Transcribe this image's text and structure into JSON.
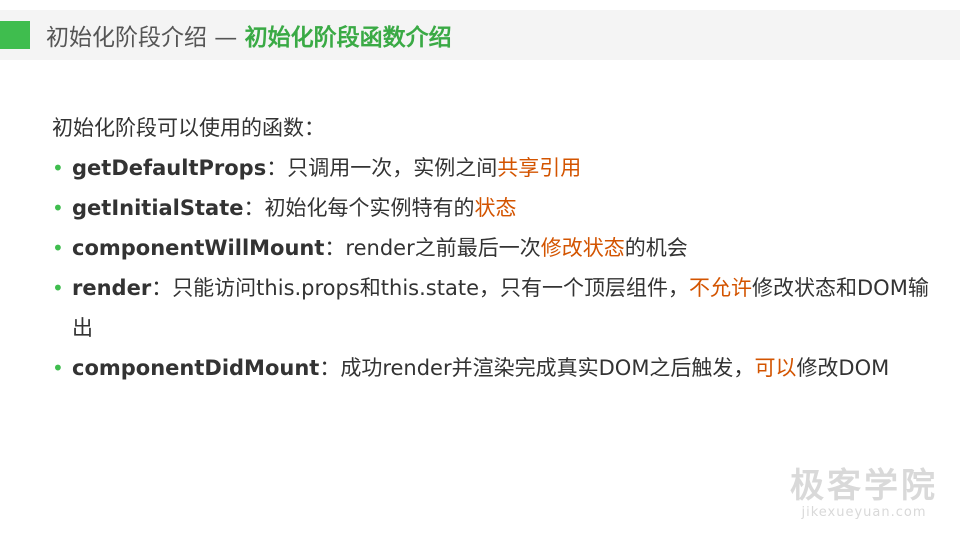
{
  "header": {
    "section": "初始化阶段介绍 — ",
    "subtitle": "初始化阶段函数介绍"
  },
  "intro": "初始化阶段可以使用的函数：",
  "items": [
    {
      "term": "getDefaultProps",
      "sep": "：",
      "text1": "只调用一次，实例之间",
      "highlight": "共享引用",
      "text2": ""
    },
    {
      "term": "getInitialState",
      "sep": "：",
      "text1": "初始化每个实例特有的",
      "highlight": "状态",
      "text2": ""
    },
    {
      "term": "componentWillMount",
      "sep": "：",
      "text1": "render之前最后一次",
      "highlight": "修改状态",
      "text2": "的机会"
    },
    {
      "term": "render",
      "sep": "：",
      "text1": "只能访问this.props和this.state，只有一个顶层组件，",
      "highlight": "不允许",
      "text2": "修改状态和DOM输出"
    },
    {
      "term": "componentDidMount",
      "sep": "：",
      "text1": "成功render并渲染完成真实DOM之后触发，",
      "highlight": "可以",
      "text2": "修改DOM"
    }
  ],
  "watermark": {
    "name": "极客学院",
    "url": "jikexueyuan.com"
  },
  "colors": {
    "accent_green": "#3fbd4e",
    "highlight_orange": "#d35400"
  }
}
